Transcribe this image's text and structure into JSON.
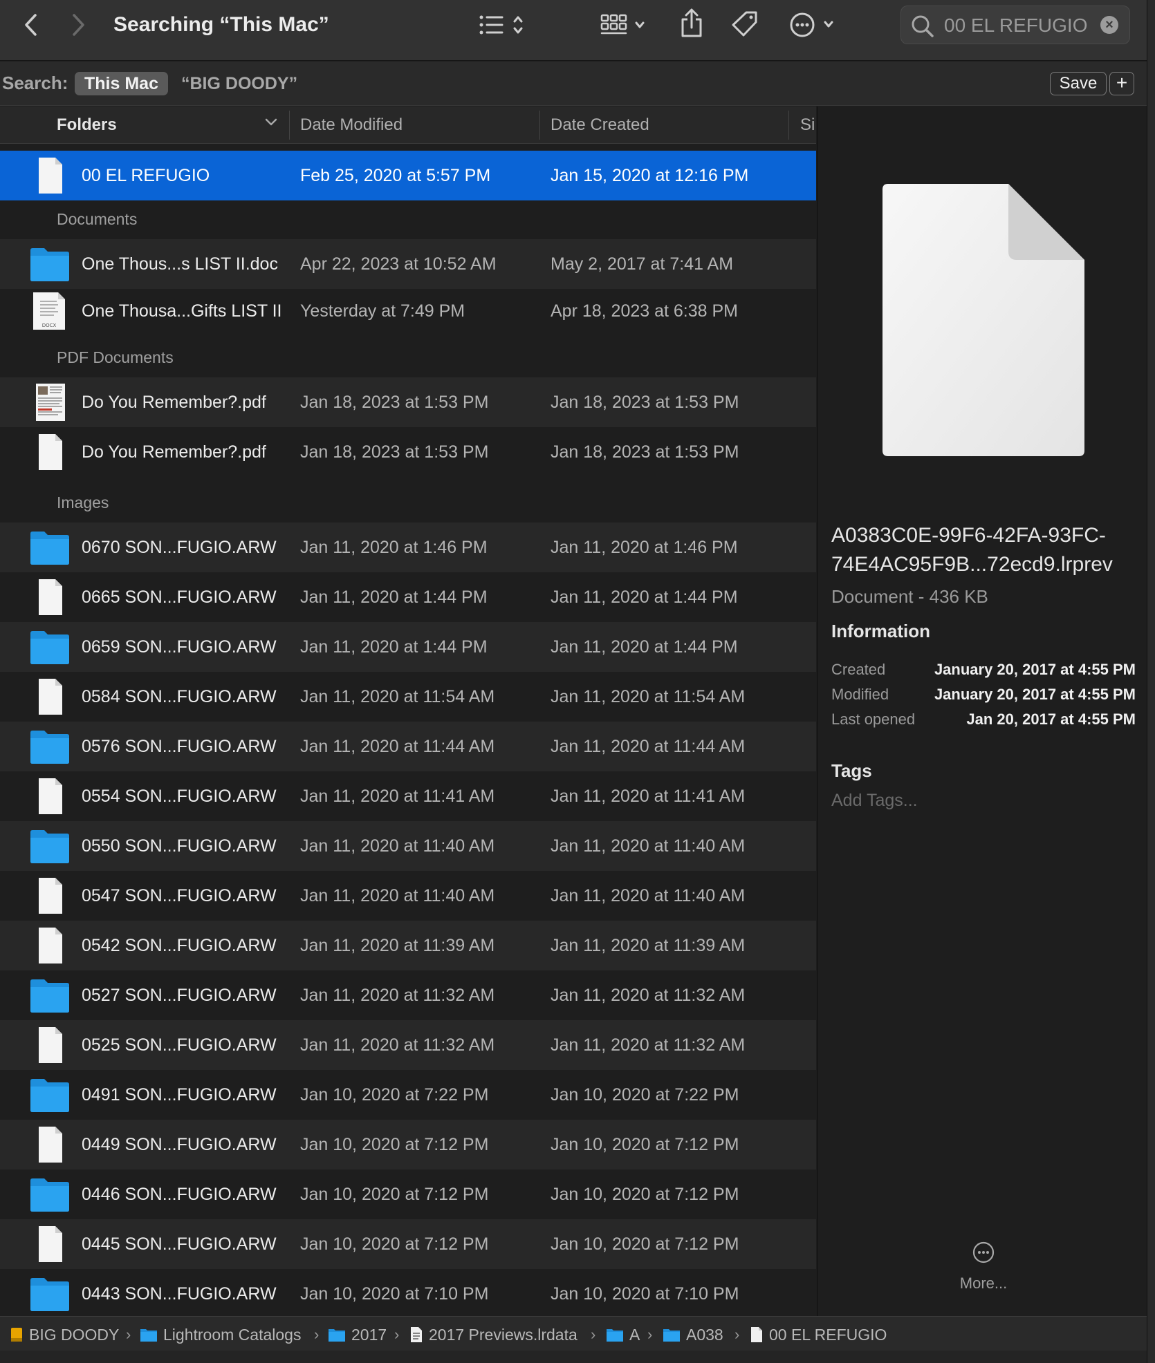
{
  "window": {
    "title": "Searching “This Mac”",
    "search_query": "00 EL REFUGIO"
  },
  "scope": {
    "label": "Search:",
    "this_mac": "This Mac",
    "other": "“BIG DOODY”",
    "save_label": "Save",
    "add_label": "+"
  },
  "columns": {
    "name": "Folders",
    "date_modified": "Date Modified",
    "date_created": "Date Created",
    "size": "Si"
  },
  "groups": {
    "documents": "Documents",
    "pdf": "PDF Documents",
    "images": "Images"
  },
  "rows": [
    {
      "name": "00 EL REFUGIO",
      "modified": "Feb 25, 2020 at 5:57 PM",
      "created": "Jan 15, 2020 at 12:16 PM",
      "icon": "blank-document-icon"
    },
    {
      "name": "One Thous...s LIST II.doc",
      "modified": "Apr 22, 2023 at 10:52 AM",
      "created": "May 2, 2017 at 7:41 AM",
      "icon": "folder-icon"
    },
    {
      "name": "One Thousa...Gifts LIST II",
      "modified": "Yesterday at 7:49 PM",
      "created": "Apr 18, 2023 at 6:38 PM",
      "icon": "docx-icon",
      "badge": "DOCX"
    },
    {
      "name": "Do You Remember?.pdf",
      "modified": "Jan 18, 2023 at 1:53 PM",
      "created": "Jan 18, 2023 at 1:53 PM",
      "icon": "pdf-thumbnail-icon"
    },
    {
      "name": "Do You Remember?.pdf",
      "modified": "Jan 18, 2023 at 1:53 PM",
      "created": "Jan 18, 2023 at 1:53 PM",
      "icon": "blank-document-icon"
    },
    {
      "name": "0670  SON...FUGIO.ARW",
      "modified": "Jan 11, 2020 at 1:46 PM",
      "created": "Jan 11, 2020 at 1:46 PM",
      "icon": "folder-icon"
    },
    {
      "name": "0665  SON...FUGIO.ARW",
      "modified": "Jan 11, 2020 at 1:44 PM",
      "created": "Jan 11, 2020 at 1:44 PM",
      "icon": "blank-document-icon"
    },
    {
      "name": "0659  SON...FUGIO.ARW",
      "modified": "Jan 11, 2020 at 1:44 PM",
      "created": "Jan 11, 2020 at 1:44 PM",
      "icon": "folder-icon"
    },
    {
      "name": "0584  SON...FUGIO.ARW",
      "modified": "Jan 11, 2020 at 11:54 AM",
      "created": "Jan 11, 2020 at 11:54 AM",
      "icon": "blank-document-icon"
    },
    {
      "name": "0576  SON...FUGIO.ARW",
      "modified": "Jan 11, 2020 at 11:44 AM",
      "created": "Jan 11, 2020 at 11:44 AM",
      "icon": "folder-icon"
    },
    {
      "name": "0554  SON...FUGIO.ARW",
      "modified": "Jan 11, 2020 at 11:41 AM",
      "created": "Jan 11, 2020 at 11:41 AM",
      "icon": "blank-document-icon"
    },
    {
      "name": "0550  SON...FUGIO.ARW",
      "modified": "Jan 11, 2020 at 11:40 AM",
      "created": "Jan 11, 2020 at 11:40 AM",
      "icon": "folder-icon"
    },
    {
      "name": "0547  SON...FUGIO.ARW",
      "modified": "Jan 11, 2020 at 11:40 AM",
      "created": "Jan 11, 2020 at 11:40 AM",
      "icon": "blank-document-icon"
    },
    {
      "name": "0542  SON...FUGIO.ARW",
      "modified": "Jan 11, 2020 at 11:39 AM",
      "created": "Jan 11, 2020 at 11:39 AM",
      "icon": "blank-document-icon"
    },
    {
      "name": "0527  SON...FUGIO.ARW",
      "modified": "Jan 11, 2020 at 11:32 AM",
      "created": "Jan 11, 2020 at 11:32 AM",
      "icon": "folder-icon"
    },
    {
      "name": "0525  SON...FUGIO.ARW",
      "modified": "Jan 11, 2020 at 11:32 AM",
      "created": "Jan 11, 2020 at 11:32 AM",
      "icon": "blank-document-icon"
    },
    {
      "name": "0491  SON...FUGIO.ARW",
      "modified": "Jan 10, 2020 at 7:22 PM",
      "created": "Jan 10, 2020 at 7:22 PM",
      "icon": "folder-icon"
    },
    {
      "name": "0449  SON...FUGIO.ARW",
      "modified": "Jan 10, 2020 at 7:12 PM",
      "created": "Jan 10, 2020 at 7:12 PM",
      "icon": "blank-document-icon"
    },
    {
      "name": "0446  SON...FUGIO.ARW",
      "modified": "Jan 10, 2020 at 7:12 PM",
      "created": "Jan 10, 2020 at 7:12 PM",
      "icon": "folder-icon"
    },
    {
      "name": "0445  SON...FUGIO.ARW",
      "modified": "Jan 10, 2020 at 7:12 PM",
      "created": "Jan 10, 2020 at 7:12 PM",
      "icon": "blank-document-icon"
    },
    {
      "name": "0443  SON...FUGIO.ARW",
      "modified": "Jan 10, 2020 at 7:10 PM",
      "created": "Jan 10, 2020 at 7:10 PM",
      "icon": "folder-icon"
    }
  ],
  "preview": {
    "name_line1": "A0383C0E-99F6-42FA-93FC-",
    "name_line2": "74E4AC95F9B...72ecd9.lrprev",
    "kind": "Document - 436 KB",
    "information": "Information",
    "created_label": "Created",
    "created_value": "January 20, 2017 at 4:55 PM",
    "modified_label": "Modified",
    "modified_value": "January 20, 2017 at 4:55 PM",
    "last_opened_label": "Last opened",
    "last_opened_value": "Jan 20, 2017 at 4:55 PM",
    "tags": "Tags",
    "add_tags": "Add Tags...",
    "more": "More..."
  },
  "path": [
    {
      "label": "BIG DOODY",
      "icon": "drive-icon"
    },
    {
      "label": "Lightroom Catalogs",
      "icon": "folder-icon"
    },
    {
      "label": "2017",
      "icon": "folder-icon"
    },
    {
      "label": "2017 Previews.lrdata",
      "icon": "document-icon"
    },
    {
      "label": "A",
      "icon": "folder-icon"
    },
    {
      "label": "A038",
      "icon": "folder-icon"
    },
    {
      "label": "00 EL REFUGIO",
      "icon": "blank-document-icon"
    }
  ],
  "colors": {
    "selection": "#0a64d6",
    "folder": "#2aa3f0",
    "drive": "#e8a400"
  }
}
